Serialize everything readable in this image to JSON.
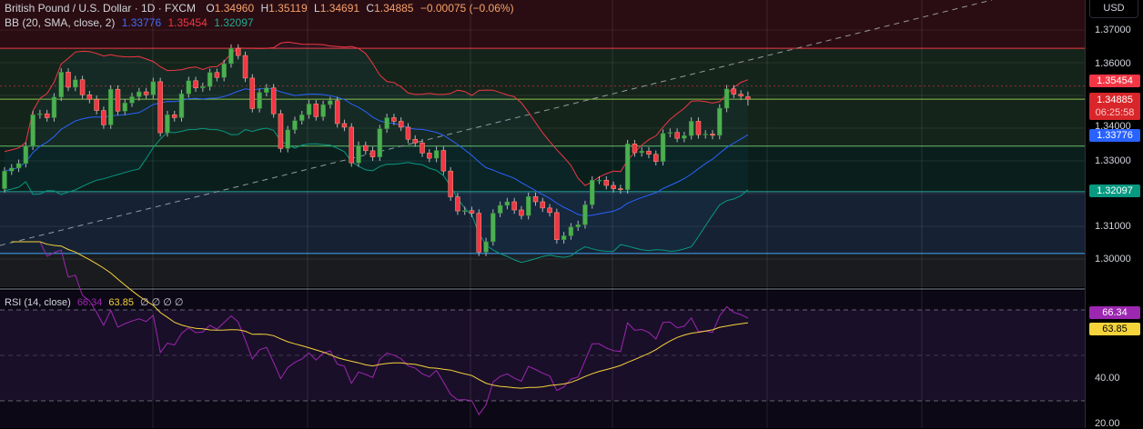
{
  "header": {
    "symbol": "British Pound / U.S. Dollar · 1D · FXCM",
    "open_label": "O",
    "open": "1.34960",
    "high_label": "H",
    "high": "1.35119",
    "low_label": "L",
    "low": "1.34691",
    "close_label": "C",
    "close": "1.34885",
    "change": "−0.00075 (−0.06%)"
  },
  "bb_legend": {
    "label": "BB (20, SMA, close, 2)",
    "basis": "1.33776",
    "upper": "1.35454",
    "lower": "1.32097"
  },
  "rsi_legend": {
    "label": "RSI (14, close)",
    "rsi": "66.34",
    "ma": "63.85",
    "extra": "∅ ∅ ∅ ∅"
  },
  "axis": {
    "currency": "USD",
    "price_ticks": [
      "1.37000",
      "1.36000",
      "1.34000",
      "1.33000",
      "1.31000",
      "1.30000"
    ],
    "rsi_ticks": [
      "40.00",
      "20.00"
    ],
    "tags": {
      "upper": "1.35454",
      "last": "1.34885",
      "countdown": "06:25:58",
      "basis": "1.33776",
      "lower": "1.32097",
      "rsi": "66.34",
      "rsi_ma": "63.85"
    }
  },
  "colors": {
    "up": "#4caf50",
    "down": "#f23645",
    "basis": "#2962ff",
    "upper": "#f23645",
    "lower": "#089981",
    "rsi": "#9c27b0",
    "rsi_ma": "#f5d33b"
  },
  "chart_data": {
    "type": "candlestick",
    "title": "British Pound / U.S. Dollar · 1D · FXCM",
    "ylim": [
      1.297,
      1.372
    ],
    "price_ticks": [
      1.37,
      1.36,
      1.34,
      1.33,
      1.31,
      1.3
    ],
    "first_open": 1.3215,
    "closes": [
      1.3269,
      1.3278,
      1.3292,
      1.3345,
      1.3441,
      1.3444,
      1.3432,
      1.3495,
      1.3571,
      1.3525,
      1.3548,
      1.3502,
      1.3488,
      1.3454,
      1.341,
      1.3519,
      1.3452,
      1.3477,
      1.3496,
      1.3511,
      1.3502,
      1.3542,
      1.3386,
      1.3441,
      1.3432,
      1.3505,
      1.3545,
      1.3523,
      1.3527,
      1.357,
      1.3555,
      1.3597,
      1.3644,
      1.3622,
      1.3553,
      1.346,
      1.3509,
      1.3523,
      1.3444,
      1.3338,
      1.3395,
      1.3423,
      1.3441,
      1.3474,
      1.3435,
      1.3472,
      1.3484,
      1.3414,
      1.3403,
      1.3294,
      1.3347,
      1.3331,
      1.3312,
      1.3398,
      1.3432,
      1.3421,
      1.3403,
      1.3366,
      1.3355,
      1.3324,
      1.3308,
      1.3332,
      1.3269,
      1.319,
      1.3147,
      1.3148,
      1.314,
      1.3021,
      1.3053,
      1.314,
      1.3164,
      1.3175,
      1.315,
      1.3133,
      1.3191,
      1.3175,
      1.3156,
      1.3142,
      1.3059,
      1.3071,
      1.3098,
      1.3105,
      1.3166,
      1.3241,
      1.3241,
      1.3225,
      1.3215,
      1.3212,
      1.3352,
      1.3325,
      1.333,
      1.332,
      1.3298,
      1.3384,
      1.3387,
      1.3369,
      1.3377,
      1.3421,
      1.338,
      1.3382,
      1.3378,
      1.3461,
      1.352,
      1.3504,
      1.3498,
      1.34885
    ],
    "last_ohlc": {
      "open": 1.3496,
      "high": 1.35119,
      "low": 1.34691,
      "close": 1.34885
    },
    "horizontal_levels": [
      1.3644,
      1.34885,
      1.3345,
      1.3206,
      1.3017
    ],
    "bollinger": {
      "period": 20,
      "mult": 2,
      "basis": 1.33776,
      "upper": 1.35454,
      "lower": 1.32097
    },
    "rsi": {
      "period": 14,
      "value": 66.34,
      "ma": 63.85,
      "ylim": [
        16,
        76
      ],
      "levels": [
        70,
        50,
        30
      ],
      "ticks": [
        40,
        20
      ]
    }
  }
}
